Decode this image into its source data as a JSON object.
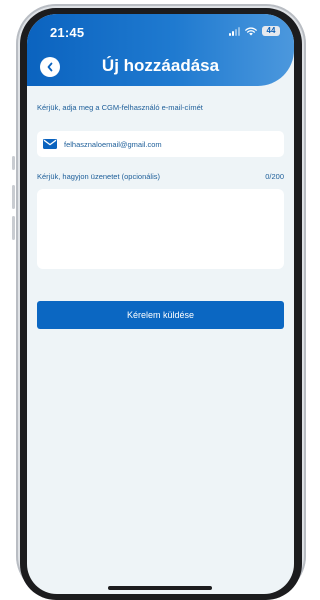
{
  "status_bar": {
    "time": "21:45",
    "battery": "44"
  },
  "header": {
    "title": "Új hozzáadása",
    "back_icon": "chevron-left-icon"
  },
  "form": {
    "email_label": "Kérjük, adja meg a CGM-felhasználó e-mail-címét",
    "email_icon": "mail-icon",
    "email_value": "felhasznaloemail@gmail.com",
    "message_label": "Kérjük, hagyjon üzenetet (opcionális)",
    "message_counter": "0/200",
    "message_value": ""
  },
  "actions": {
    "submit_label": "Kérelem küldése"
  },
  "colors": {
    "primary": "#0b67c2",
    "label_text": "#1d5e99",
    "screen_background": "#eef4f7"
  }
}
